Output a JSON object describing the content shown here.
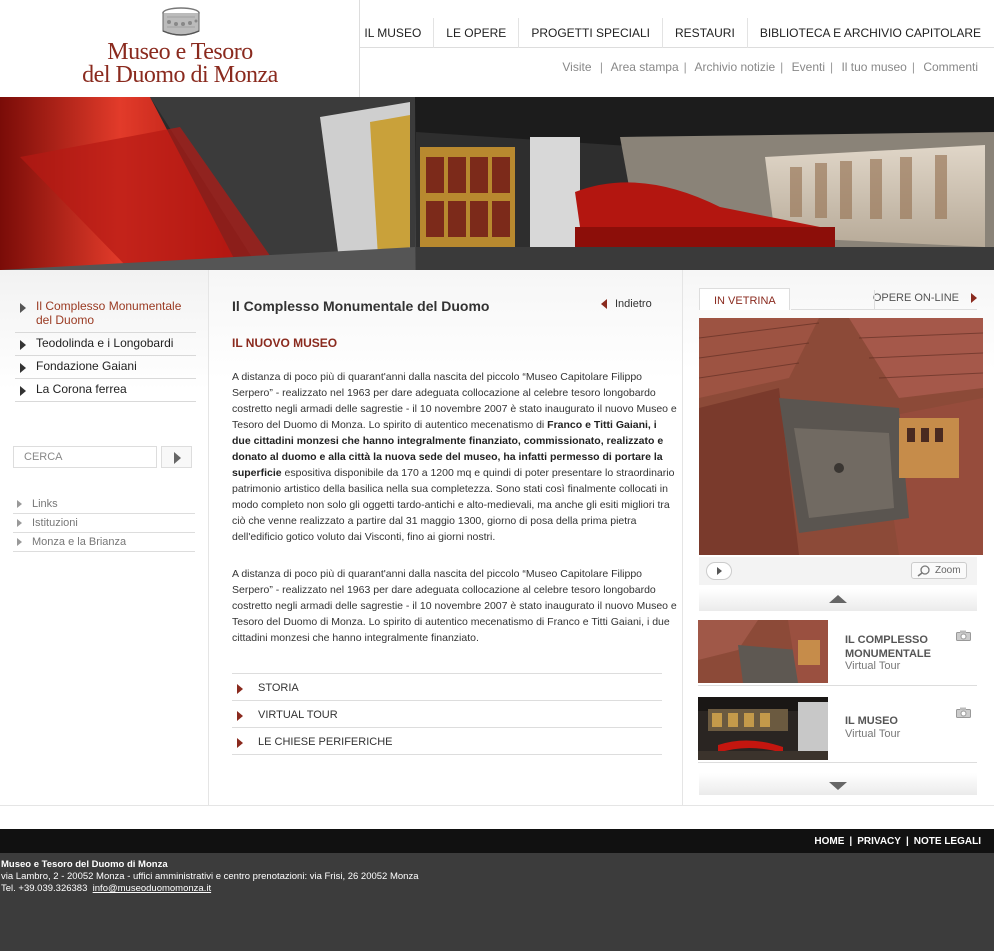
{
  "logo": {
    "line1": "Museo e Tesoro",
    "line2": "del Duomo di Monza"
  },
  "main_nav": [
    "IL MUSEO",
    "LE OPERE",
    "PROGETTI SPECIALI",
    "RESTAURI",
    "BIBLIOTECA E ARCHIVIO CAPITOLARE"
  ],
  "sub_nav": [
    "Visite",
    "Area stampa",
    "Archivio notizie",
    "Eventi",
    "Il tuo museo",
    "Commenti"
  ],
  "left_menu": {
    "items": [
      {
        "label": "Il Complesso Monumentale del Duomo",
        "active": true
      },
      {
        "label": "Teodolinda e i  Longobardi",
        "active": false
      },
      {
        "label": "Fondazione Gaiani",
        "active": false
      },
      {
        "label": "La Corona ferrea",
        "active": false
      }
    ],
    "search_placeholder": "CERCA",
    "links": [
      "Links",
      "Istituzioni",
      "Monza e la Brianza"
    ]
  },
  "content": {
    "title": "Il Complesso Monumentale  del Duomo",
    "back_label": "Indietro",
    "section_title": "IL NUOVO MUSEO",
    "p1_a": "A distanza di poco più di quarant'anni dalla nascita del piccolo “Museo Capitolare Filippo Serpero” - realizzato nel 1963 per dare adeguata collocazione al celebre tesoro longobardo costretto negli armadi delle sagrestie - il 10 novembre 2007 è stato inaugurato il nuovo Museo e Tesoro del Duomo di Monza. Lo spirito di autentico mecenatismo di ",
    "p1_bold": "Franco e Titti Gaiani, i due cittadini monzesi che hanno integralmente finanziato, commissionato, realizzato e donato al duomo e alla città la nuova sede del museo, ha infatti permesso di portare la superficie",
    "p1_b": " espositiva disponibile da 170 a 1200 mq e quindi di poter presentare lo straordinario patrimonio artistico della basilica nella sua completezza. Sono stati così finalmente collocati in modo completo non solo gli oggetti tardo-antichi e alto-medievali, ma anche gli esiti migliori tra ciò che venne realizzato a partire dal 31 maggio 1300, giorno di posa della prima pietra dell'edificio gotico voluto dai Visconti, fino ai giorni nostri.",
    "p2": "A distanza di poco più di quarant'anni dalla nascita del piccolo “Museo Capitolare Filippo Serpero” - realizzato nel 1963 per dare adeguata collocazione al celebre tesoro longobardo costretto negli armadi delle sagrestie - il 10 novembre 2007 è stato inaugurato il nuovo Museo e Tesoro del Duomo di Monza. Lo spirito di autentico mecenatismo di Franco e Titti Gaiani, i due cittadini monzesi che hanno integralmente finanziato.",
    "sub_links": [
      "STORIA",
      "VIRTUAL TOUR",
      "LE CHIESE PERIFERICHE"
    ]
  },
  "right": {
    "tab_active": "IN VETRINA",
    "tab_other": "OPERE ON-LINE",
    "zoom_label": "Zoom",
    "items": [
      {
        "title": "IL COMPLESSO MONUMENTALE",
        "subtitle": "Virtual Tour"
      },
      {
        "title": "IL MUSEO",
        "subtitle": "Virtual Tour"
      }
    ]
  },
  "footer": {
    "links": [
      "HOME",
      "PRIVACY",
      "NOTE LEGALI"
    ],
    "name": "Museo e Tesoro del Duomo di Monza",
    "address": "via Lambro, 2  - 20052 Monza  -  uffici amministrativi e centro prenotazioni: via Frisi, 26  20052 Monza",
    "tel": "Tel. +39.039.326383",
    "email": "info@museoduomomonza.it"
  },
  "colors": {
    "brand": "#8a2a1e",
    "footer_dark": "#111111",
    "footer_grey": "#3c3c3c"
  }
}
